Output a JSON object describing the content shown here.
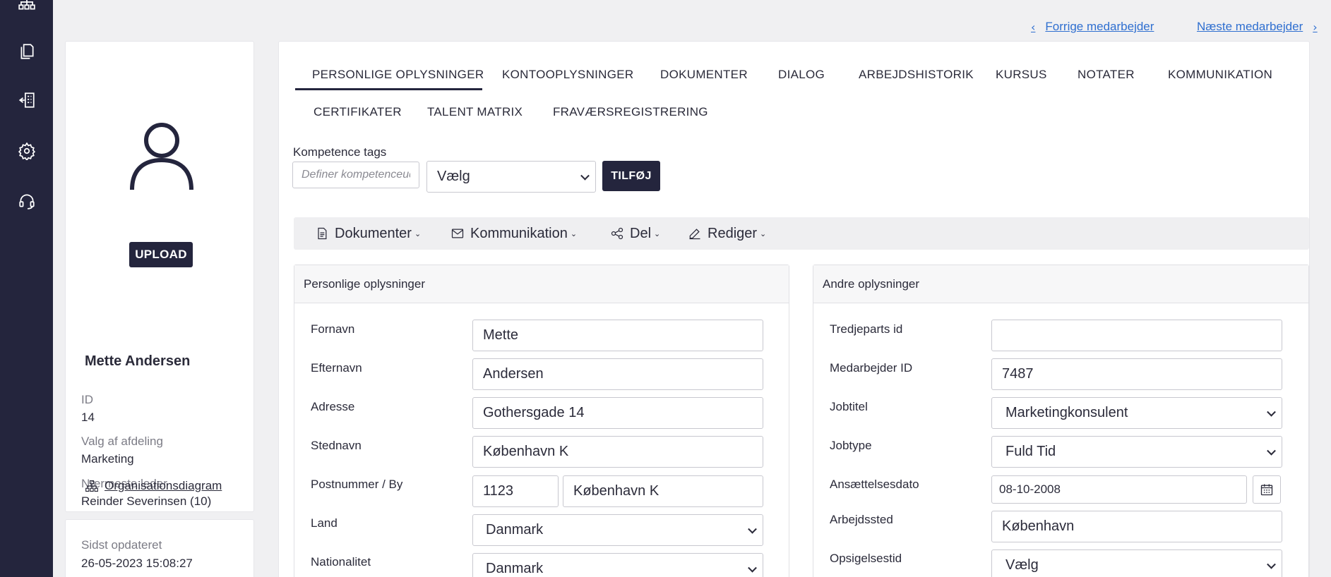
{
  "nav": {
    "prev_label": "Forrige medarbejder",
    "next_label": "Næste medarbejder"
  },
  "rail": {
    "icons": [
      "org-chart-icon",
      "documents-icon",
      "building-icon",
      "gear-icon",
      "headset-icon"
    ]
  },
  "profile": {
    "upload_label": "UPLOAD",
    "name": "Mette Andersen",
    "id_label": "ID",
    "id_value": "14",
    "department_label": "Valg af afdeling",
    "department_value": "Marketing",
    "manager_label": "Nærmeste leder",
    "manager_value": "Reinder Severinsen (10)",
    "org_link_label": "Organisationsdiagram"
  },
  "updated": {
    "label": "Sidst opdateret",
    "value": "26-05-2023 15:08:27"
  },
  "tabs": [
    {
      "label": "PERSONLIGE OPLYSNINGER",
      "active": true
    },
    {
      "label": "KONTOOPLYSNINGER"
    },
    {
      "label": "DOKUMENTER"
    },
    {
      "label": "DIALOG"
    },
    {
      "label": "ARBEJDSHISTORIK"
    },
    {
      "label": "KURSUS"
    },
    {
      "label": "NOTATER"
    },
    {
      "label": "KOMMUNIKATION"
    },
    {
      "label": "CERTIFIKATER"
    },
    {
      "label": "TALENT MATRIX"
    },
    {
      "label": "FRAVÆRSREGISTRERING"
    }
  ],
  "competence": {
    "label": "Kompetence tags",
    "placeholder": "Definer kompetenceudvikling",
    "select_value": "Vælg",
    "add_label": "TILFØJ"
  },
  "toolbar": {
    "documents": "Dokumenter",
    "communication": "Kommunikation",
    "share": "Del",
    "edit": "Rediger"
  },
  "personal": {
    "title": "Personlige oplysninger",
    "first_name_label": "Fornavn",
    "first_name": "Mette",
    "last_name_label": "Efternavn",
    "last_name": "Andersen",
    "address_label": "Adresse",
    "address": "Gothersgade 14",
    "place_label": "Stednavn",
    "place": "København K",
    "postal_label": "Postnummer / By",
    "postal_code": "1123",
    "city": "København K",
    "country_label": "Land",
    "country": "Danmark",
    "nationality_label": "Nationalitet",
    "nationality": "Danmark"
  },
  "other": {
    "title": "Andre oplysninger",
    "third_party_label": "Tredjeparts id",
    "third_party": "",
    "employee_id_label": "Medarbejder ID",
    "employee_id": "7487",
    "job_title_label": "Jobtitel",
    "job_title": "Marketingkonsulent",
    "job_type_label": "Jobtype",
    "job_type": "Fuld Tid",
    "hire_date_label": "Ansættelsesdato",
    "hire_date": "08-10-2008",
    "workplace_label": "Arbejdssted",
    "workplace": "København",
    "notice_label": "Opsigelsestid",
    "notice": "Vælg"
  }
}
